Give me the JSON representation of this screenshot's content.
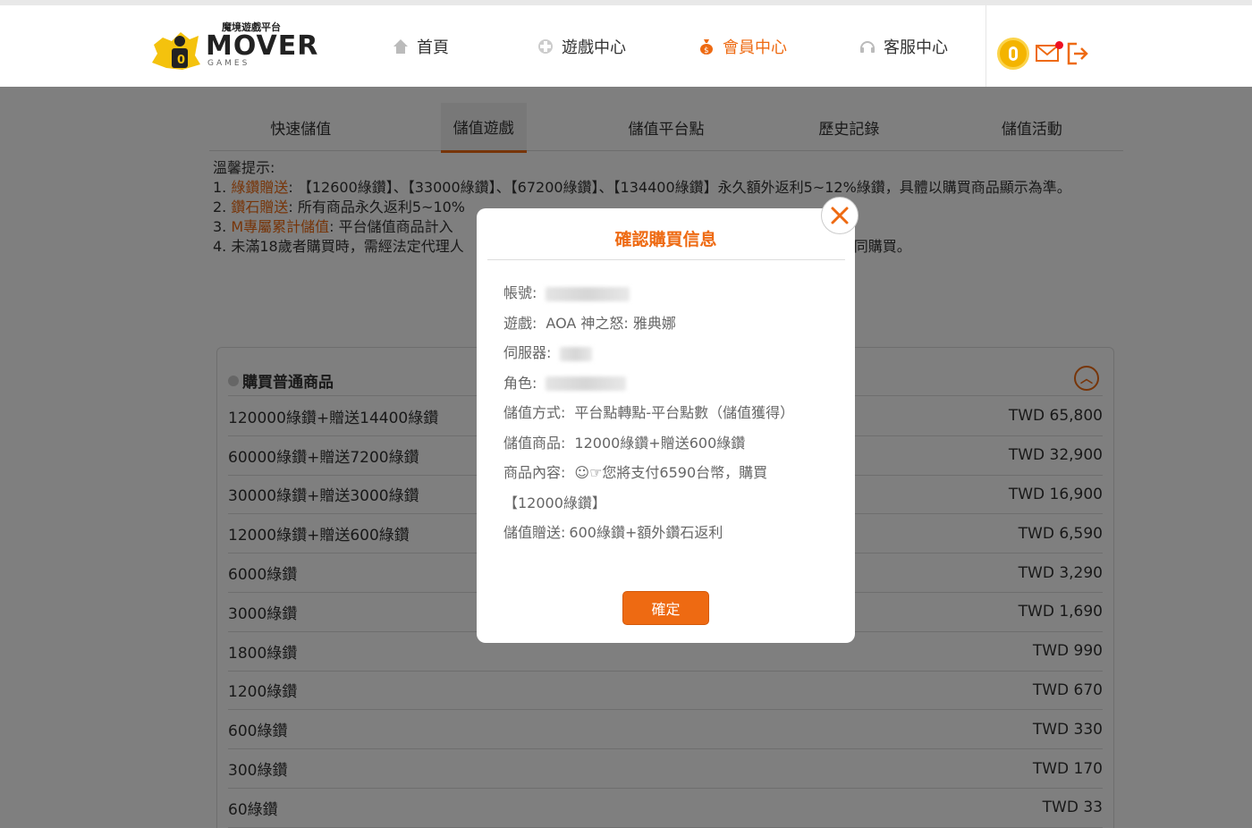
{
  "header": {
    "logo": {
      "sub": "魔境遊戲平台",
      "main": "MOVER",
      "games": "GAMES"
    },
    "nav": [
      {
        "label": "首頁",
        "icon": "home-icon",
        "active": false
      },
      {
        "label": "遊戲中心",
        "icon": "gamepad-icon",
        "active": false
      },
      {
        "label": "會員中心",
        "icon": "money-bag-icon",
        "active": true
      },
      {
        "label": "客服中心",
        "icon": "headset-icon",
        "active": false
      }
    ],
    "notification_color": "#e11122",
    "accent_color": "#ee6a12"
  },
  "subtabs": [
    "快速儲值",
    "儲值遊戲",
    "儲值平台點",
    "歷史記錄",
    "儲值活動"
  ],
  "subtabs_active": "儲值遊戲",
  "tips": {
    "title": "溫馨提示:",
    "l1_pre": "1.",
    "l1_hl": "綠鑽贈送",
    "l1_text": ": 【12600綠鑽】、【33000綠鑽】、【67200綠鑽】、【134400綠鑽】永久額外返利5~12%綠鑽，具體以購買商品顯示為準。",
    "l2_pre": "2.",
    "l2_hl": "鑽石贈送",
    "l2_text": ": 所有商品永久返利5~10%",
    "l3_pre": "3.",
    "l3_hl": "M專屬累計儲值",
    "l3_text": ": 平台儲值商品計入",
    "l4": "4. 未滿18歲者購買時，需經法定代理人",
    "l4_end": "陪同購買。"
  },
  "goods": {
    "title": "購買普通商品",
    "items": [
      {
        "name": "120000綠鑽+贈送14400綠鑽",
        "price": "TWD 65,800"
      },
      {
        "name": "60000綠鑽+贈送7200綠鑽",
        "price": "TWD 32,900"
      },
      {
        "name": "30000綠鑽+贈送3000綠鑽",
        "price": "TWD 16,900"
      },
      {
        "name": "12000綠鑽+贈送600綠鑽",
        "price": "TWD 6,590"
      },
      {
        "name": "6000綠鑽",
        "price": "TWD 3,290"
      },
      {
        "name": "3000綠鑽",
        "price": "TWD 1,690"
      },
      {
        "name": "1800綠鑽",
        "price": "TWD 990"
      },
      {
        "name": "1200綠鑽",
        "price": "TWD 670"
      },
      {
        "name": "600綠鑽",
        "price": "TWD 330"
      },
      {
        "name": "300綠鑽",
        "price": "TWD 170"
      },
      {
        "name": "60綠鑽",
        "price": "TWD 33"
      }
    ]
  },
  "modal": {
    "title": "確認購買信息",
    "account_label": "帳號:",
    "game_label": "遊戲:",
    "game_value": "AOA 神之怒: 雅典娜",
    "server_label": "伺服器:",
    "role_label": "角色:",
    "method_label": "儲值方式:",
    "method_value": "平台點轉點-平台點數（儲值獲得）",
    "product_label": "儲值商品:",
    "product_value": "12000綠鑽+贈送600綠鑽",
    "content_label": "商品內容:",
    "content_value": "☺☞您將支付6590台幣，購買",
    "content_value2": "【12000綠鑽】",
    "bonus_label": "儲值贈送:",
    "bonus_value": "600綠鑽+額外鑽石返利",
    "confirm_label": "確定"
  }
}
